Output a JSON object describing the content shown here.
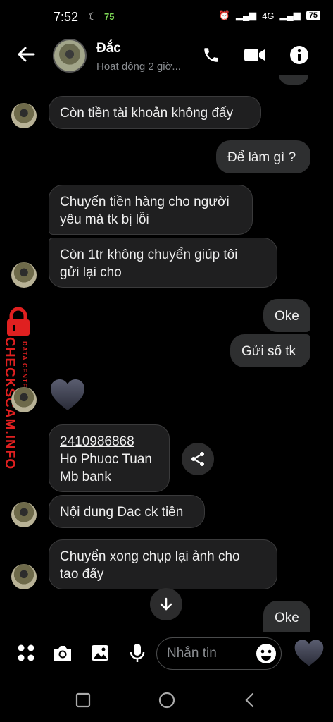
{
  "status": {
    "time": "7:52",
    "battery_small": "75",
    "network": "4G",
    "battery": "75"
  },
  "header": {
    "name": "Đắc",
    "status_text": "Hoạt động 2 giờ..."
  },
  "messages": [
    {
      "text": "Còn tiền tài khoản không đấy"
    },
    {
      "text": "Để làm gì ?"
    },
    {
      "line1": "Chuyển tiền hàng cho người",
      "line2": "yêu mà tk bị lỗi"
    },
    {
      "line1": "Còn 1tr không chuyển giúp tôi",
      "line2": "gửi lại cho"
    },
    {
      "text": "Oke"
    },
    {
      "text": "Gửi số tk"
    },
    {
      "line1": "2410986868",
      "line2": "Ho Phuoc Tuan",
      "line3": "Mb bank"
    },
    {
      "text": "Nội dung Dac ck tiền"
    },
    {
      "line1": "Chuyển xong chụp lại ảnh cho",
      "line2": "tao đấy"
    },
    {
      "text": "Oke"
    }
  ],
  "watermark": {
    "brand": "CHECKSCAM.INFO",
    "tag": "DATA CENTER"
  },
  "composer": {
    "placeholder": "Nhắn tin"
  },
  "colors": {
    "background": "#000000",
    "bubble_other": "#1f1f20",
    "bubble_mine": "#2e2f30",
    "watermark": "#e02020"
  }
}
